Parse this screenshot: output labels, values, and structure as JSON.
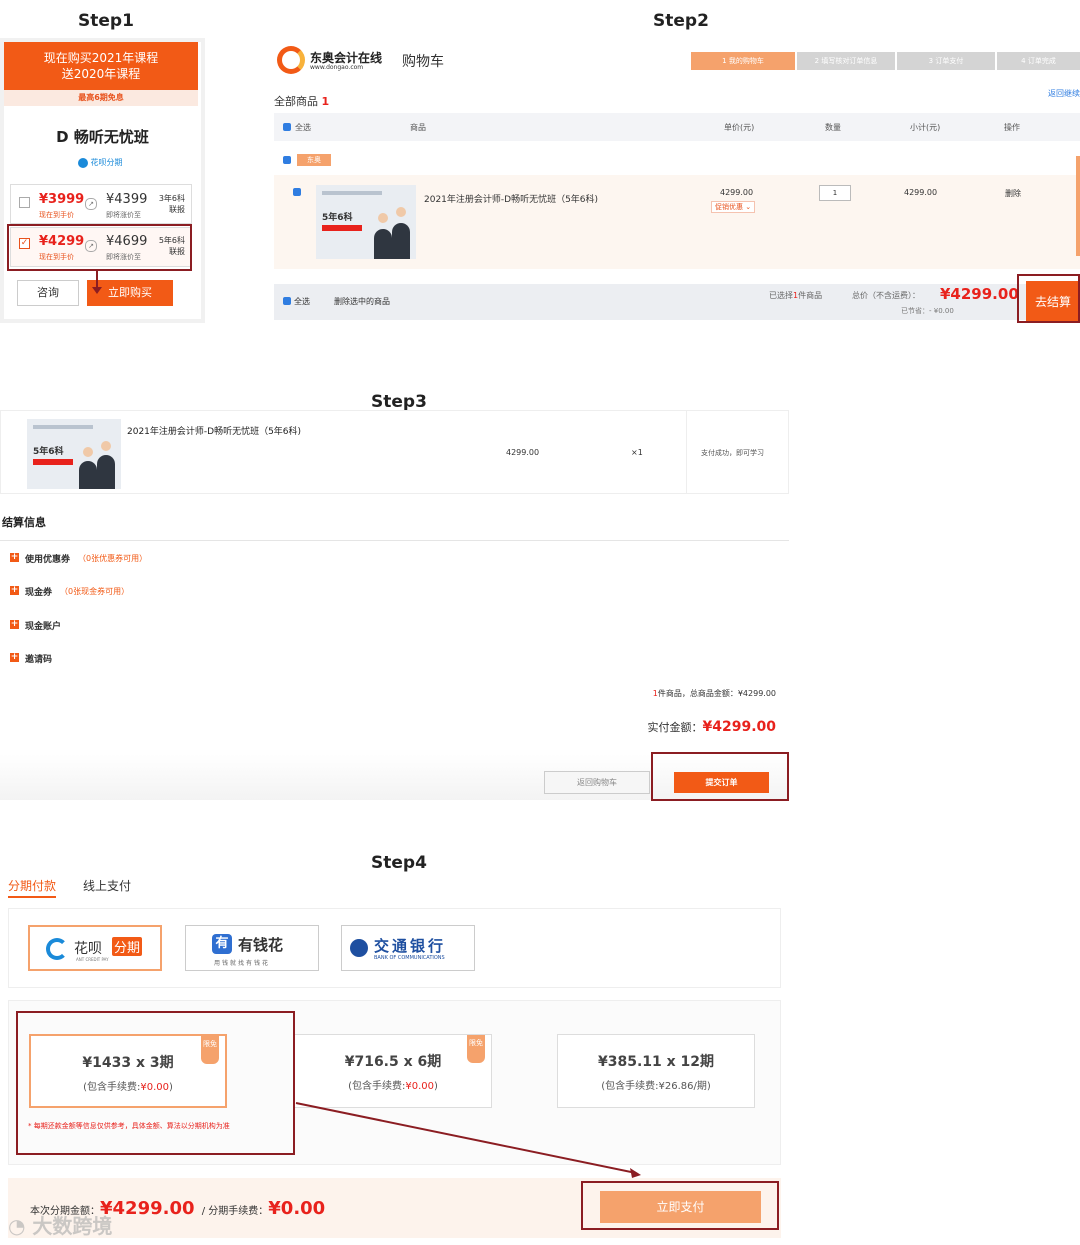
{
  "steps": {
    "step1": "Step1",
    "step2": "Step2",
    "step3": "Step3",
    "step4": "Step4"
  },
  "step1": {
    "promo_line1": "现在购买2021年课程",
    "promo_line2": "送2020年课程",
    "promo_sub": "最高6期免息",
    "course_title": "D 畅听无忧班",
    "huabei_badge": "花呗分期",
    "options": [
      {
        "price": "¥3999",
        "now_label": "现在到手价",
        "old_price": "¥4399",
        "old_label": "即将涨价至",
        "plan1": "3年6科",
        "plan2": "联报",
        "checked": false
      },
      {
        "price": "¥4299",
        "now_label": "现在到手价",
        "old_price": "¥4699",
        "old_label": "即将涨价至",
        "plan1": "5年6科",
        "plan2": "联报",
        "checked": true
      }
    ],
    "consult_label": "咨询",
    "buy_label": "立即购买"
  },
  "step2": {
    "logo_name": "东奥会计在线",
    "logo_url_text": "www.dongao.com",
    "cart_title": "购物车",
    "progress": [
      "1 我的购物车",
      "2 填写核对订单信息",
      "3 订单支付",
      "4 订单完成"
    ],
    "return_link": "返回继续",
    "all_goods_label": "全部商品",
    "all_goods_count": "1",
    "headers": {
      "select_all": "全选",
      "product": "商品",
      "unit_price": "单价(元)",
      "qty": "数量",
      "subtotal": "小计(元)",
      "action": "操作"
    },
    "shop_tag": "东奥",
    "item": {
      "name": "2021年注册会计师-D畅听无忧班（5年6科)",
      "thumb_text": "5年6科",
      "unit_price": "4299.00",
      "promo": "促销优惠",
      "qty": "1",
      "subtotal": "4299.00",
      "delete": "删除"
    },
    "footer": {
      "select_all": "全选",
      "delete_selected": "删除选中的商品",
      "selected_prefix": "已选择",
      "selected_count": "1",
      "selected_suffix": "件商品",
      "total_label": "总价（不含运费）：",
      "total": "¥4299.00",
      "saved": "已节省：- ¥0.00",
      "checkout": "去结算"
    }
  },
  "step3": {
    "item_name": "2021年注册会计师-D畅听无忧班（5年6科)",
    "thumb_text": "5年6科",
    "price": "4299.00",
    "qty": "×1",
    "note": "支付成功，即可学习",
    "section_title": "结算信息",
    "rows": [
      {
        "label": "使用优惠券",
        "note": "（0张优惠券可用）"
      },
      {
        "label": "现金券",
        "note": "（0张现金券可用）"
      },
      {
        "label": "现金账户",
        "note": ""
      },
      {
        "label": "邀请码",
        "note": ""
      }
    ],
    "summary_count": "1",
    "summary_text": "件商品，总商品金额：",
    "summary_amount": "¥4299.00",
    "actual_label": "实付金额：",
    "actual_amount": "¥4299.00",
    "back_label": "返回购物车",
    "submit_label": "提交订单"
  },
  "step4": {
    "tabs": [
      {
        "label": "分期付款",
        "active": true
      },
      {
        "label": "线上支付",
        "active": false
      }
    ],
    "providers": [
      {
        "name": "花呗",
        "tag": "分期",
        "sub": "ANT CREDIT PAY"
      },
      {
        "name": "有钱花",
        "sub": "用钱就找有钱花"
      },
      {
        "name": "交通银行",
        "sub": "BANK OF COMMUNICATIONS"
      }
    ],
    "installments": [
      {
        "amount": "¥1433 x 3期",
        "fee_prefix": "(包含手续费:",
        "fee": "¥0.00",
        "fee_suffix": ")",
        "badge": "限免"
      },
      {
        "amount": "¥716.5 x 6期",
        "fee_prefix": "(包含手续费:",
        "fee": "¥0.00",
        "fee_suffix": ")",
        "badge": "限免"
      },
      {
        "amount": "¥385.11 x 12期",
        "fee_prefix": "(包含手续费:",
        "fee": "¥26.86/期",
        "fee_suffix": ")",
        "badge": ""
      }
    ],
    "disclaimer": "* 每期还款金额等信息仅供参考，具体金额、算法以分期机构为准",
    "amount_label": "本次分期金额：",
    "amount": "¥4299.00",
    "fee_label": "/ 分期手续费：",
    "fee": "¥0.00",
    "pay_label": "立即支付",
    "watermark": "大数跨境"
  },
  "colors": {
    "brand_orange": "#f25a16",
    "price_red": "#e8221c",
    "box_red": "#8b1d22",
    "blue": "#2f7de1"
  }
}
